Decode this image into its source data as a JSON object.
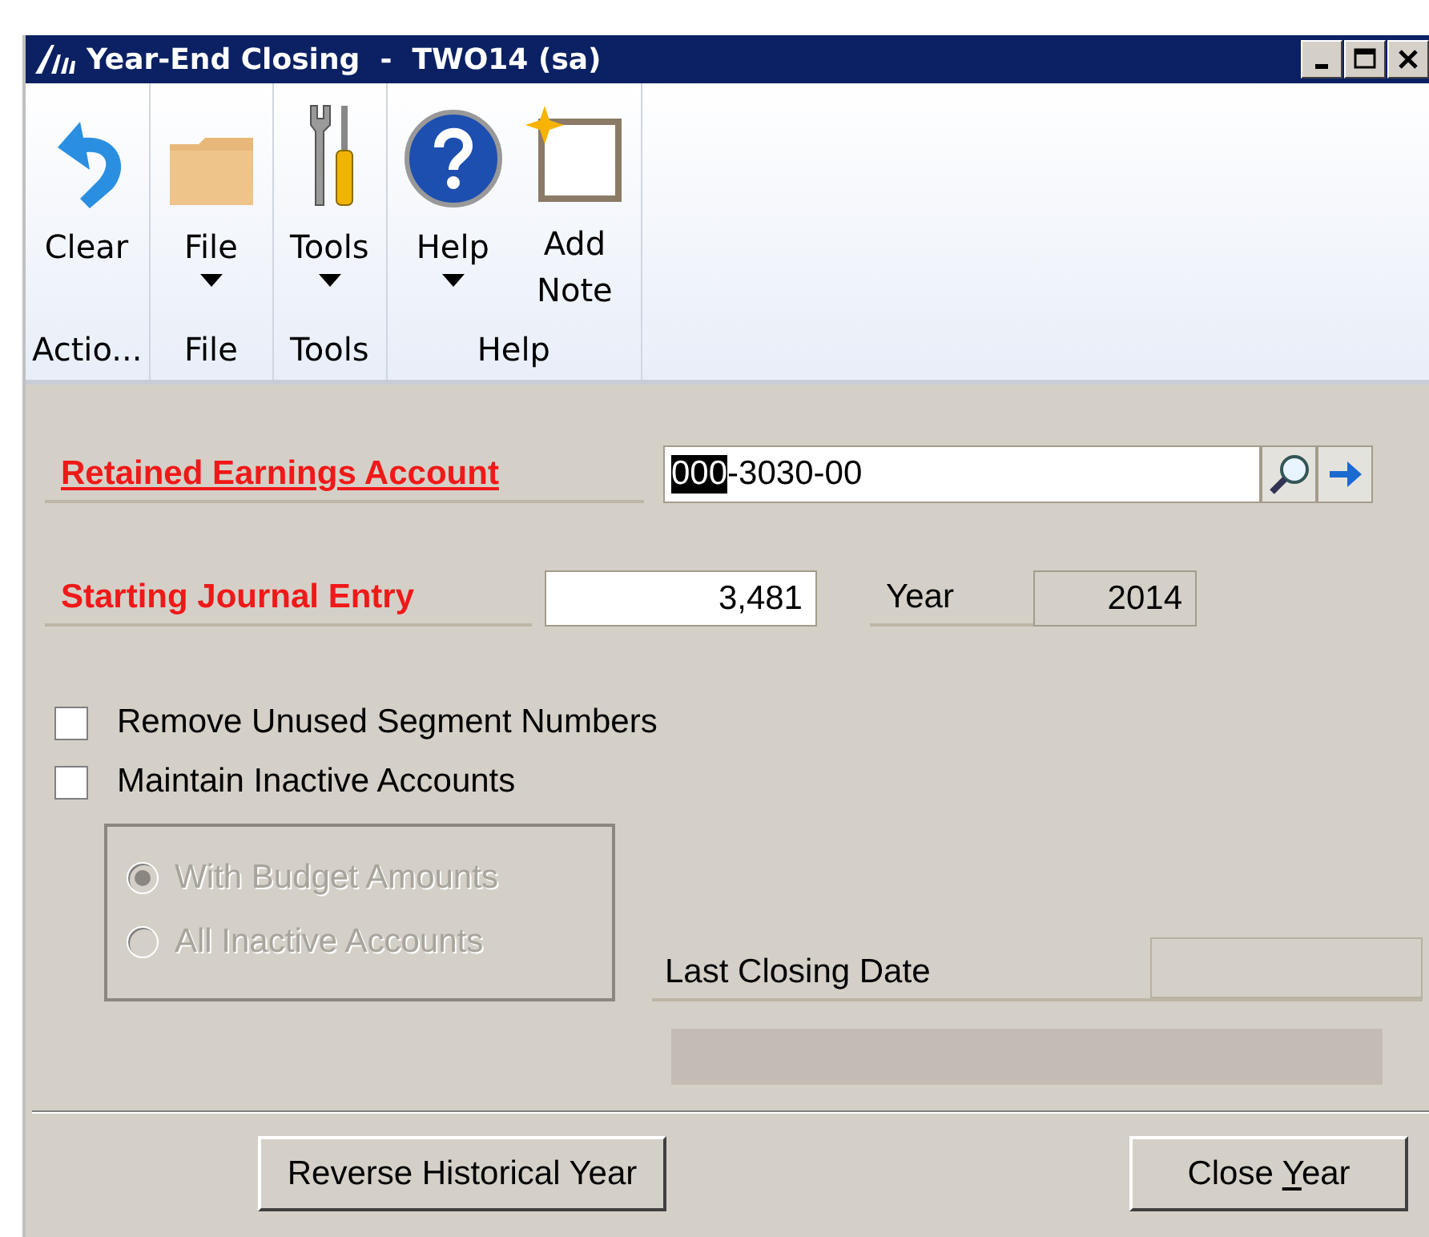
{
  "window": {
    "title": "Year-End Closing  -  TWO14 (sa)",
    "controls": [
      {
        "kind": "minimize"
      },
      {
        "kind": "maximize"
      },
      {
        "kind": "close"
      }
    ]
  },
  "ribbon": {
    "groups": [
      {
        "label": "Actio...",
        "buttons": [
          {
            "label": "Clear",
            "kind": "undo",
            "dropdown": false
          }
        ]
      },
      {
        "label": "File",
        "buttons": [
          {
            "label": "File",
            "kind": "folder",
            "dropdown": true
          }
        ]
      },
      {
        "label": "Tools",
        "buttons": [
          {
            "label": "Tools",
            "kind": "tools",
            "dropdown": true
          }
        ]
      },
      {
        "label": "Help",
        "buttons": [
          {
            "label": "Help",
            "kind": "help",
            "dropdown": true
          },
          {
            "label": "Add Note",
            "kind": "note",
            "dropdown": false
          }
        ]
      }
    ]
  },
  "form": {
    "retained_earnings": {
      "label": "Retained Earnings Account",
      "segments": [
        {
          "text": "000",
          "selected": true
        },
        {
          "text": "-3030",
          "selected": false
        },
        {
          "text": "-00",
          "selected": false
        }
      ]
    },
    "starting_journal_entry": {
      "label": "Starting Journal Entry",
      "value": "3,481"
    },
    "year": {
      "label": "Year",
      "value": "2014"
    },
    "checkboxes": [
      {
        "label": "Remove Unused Segment Numbers",
        "checked": false
      },
      {
        "label": "Maintain Inactive Accounts",
        "checked": false
      }
    ],
    "inactive_options": {
      "disabled": true,
      "options": [
        {
          "label": "With Budget Amounts",
          "selected": true
        },
        {
          "label": "All Inactive Accounts",
          "selected": false
        }
      ]
    },
    "last_closing_date": {
      "label": "Last Closing Date"
    },
    "progress": {
      "level": 0
    }
  },
  "buttons": [
    {
      "label": "Reverse Historical Year"
    },
    {
      "label": "Close ",
      "mnemonic": "Y",
      "rest": "ear"
    }
  ]
}
